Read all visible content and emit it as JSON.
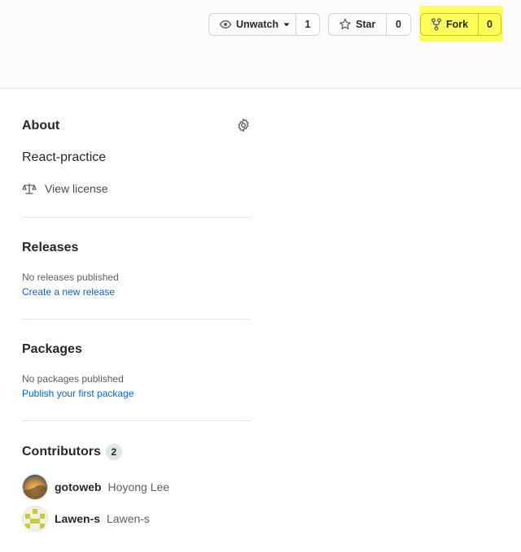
{
  "header": {
    "watch": {
      "label": "Unwatch",
      "count": "1"
    },
    "star": {
      "label": "Star",
      "count": "0"
    },
    "fork": {
      "label": "Fork",
      "count": "0"
    }
  },
  "about": {
    "title": "About",
    "description": "React-practice",
    "license_label": "View license"
  },
  "releases": {
    "title": "Releases",
    "empty_text": "No releases published",
    "link_text": "Create a new release"
  },
  "packages": {
    "title": "Packages",
    "empty_text": "No packages published",
    "link_text": "Publish your first package"
  },
  "contributors": {
    "title": "Contributors",
    "count": "2",
    "items": [
      {
        "login": "gotoweb",
        "name": "Hoyong Lee"
      },
      {
        "login": "Lawen-s",
        "name": "Lawen-s"
      }
    ]
  },
  "icons": [
    "eye-icon",
    "triangle-down-icon",
    "star-icon",
    "repo-forked-icon",
    "gear-icon",
    "law-icon"
  ],
  "colors": {
    "link": "#0366d6",
    "highlight": "#ffff3a",
    "muted": "#586069"
  }
}
